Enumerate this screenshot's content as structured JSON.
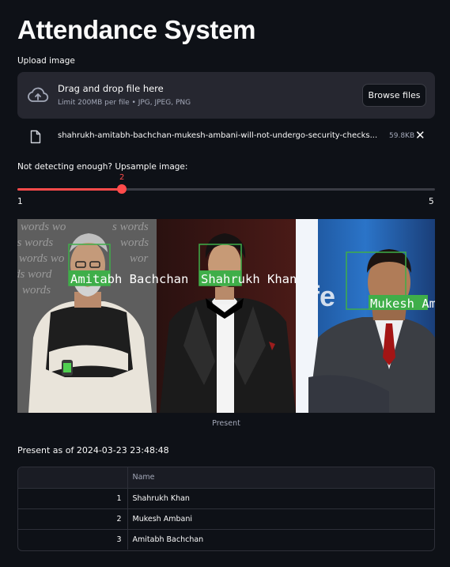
{
  "app": {
    "title": "Attendance System"
  },
  "uploader": {
    "label": "Upload image",
    "drop_text": "Drag and drop file here",
    "limit_text": "Limit 200MB per file • JPG, JPEG, PNG",
    "browse_label": "Browse files",
    "file_name": "shahrukh-amitabh-bachchan-mukesh-ambani-will-not-undergo-security-checks...",
    "file_size": "59.8KB",
    "close_glyph": "✕",
    "icons": [
      "cloud-upload-icon",
      "file-icon",
      "close-icon"
    ]
  },
  "slider": {
    "label": "Not detecting enough? Upsample image:",
    "value": "2",
    "min": "1",
    "max": "5",
    "fraction": 0.25,
    "accent_color": "#ff4b4b"
  },
  "image": {
    "labels": {
      "amitabh": "Amitabh Bachchan",
      "shahrukh": "Shahrukh Khan",
      "mukesh": "Mukesh Ambani"
    },
    "box_color": "#3fae49",
    "caption": "Present"
  },
  "present": {
    "heading": "Present as of 2024-03-23 23:48:48"
  },
  "table": {
    "columns": [
      "",
      "Name"
    ],
    "rows": [
      {
        "index": "1",
        "name": "Shahrukh Khan"
      },
      {
        "index": "2",
        "name": "Mukesh Ambani"
      },
      {
        "index": "3",
        "name": "Amitabh Bachchan"
      }
    ]
  }
}
